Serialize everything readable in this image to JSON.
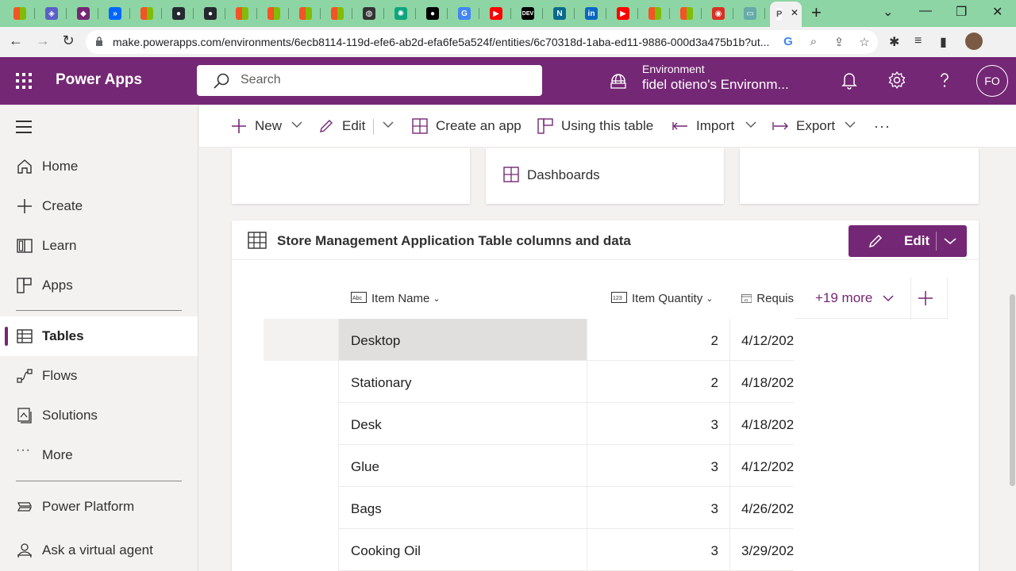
{
  "browser": {
    "active_tab_label": "P",
    "url": "make.powerapps.com/environments/6ecb8114-119d-efe6-ab2d-efa6fe5a524f/entities/6c70318d-1aba-ed11-9886-000d3a475b1b?ut...",
    "tabs": [
      {
        "icon": "microsoft-icon",
        "color": "#f35325"
      },
      {
        "icon": "power-automate-icon",
        "color": "#5b5fc7"
      },
      {
        "icon": "power-apps-icon",
        "color": "#742774"
      },
      {
        "icon": "flow-icon",
        "color": "#0066ff"
      },
      {
        "icon": "microsoft-icon",
        "color": "#f35325"
      },
      {
        "icon": "github-icon",
        "color": "#24292f"
      },
      {
        "icon": "github-icon",
        "color": "#24292f"
      },
      {
        "icon": "microsoft-icon",
        "color": "#f35325"
      },
      {
        "icon": "microsoft-icon",
        "color": "#f35325"
      },
      {
        "icon": "microsoft-icon",
        "color": "#f35325"
      },
      {
        "icon": "microsoft-icon",
        "color": "#f35325"
      },
      {
        "icon": "globe-icon",
        "color": "#333333"
      },
      {
        "icon": "openai-icon",
        "color": "#10a37f"
      },
      {
        "icon": "medium-icon",
        "color": "#000000"
      },
      {
        "icon": "google-icon",
        "color": "#4285f4"
      },
      {
        "icon": "youtube-icon",
        "color": "#ff0000"
      },
      {
        "icon": "dev-icon",
        "color": "#000000"
      },
      {
        "icon": "edge-icon",
        "color": "#0b6a8c"
      },
      {
        "icon": "linkedin-icon",
        "color": "#0a66c2"
      },
      {
        "icon": "youtube-icon",
        "color": "#ff0000"
      },
      {
        "icon": "microsoft-icon",
        "color": "#f35325"
      },
      {
        "icon": "microsoft-icon",
        "color": "#f35325"
      },
      {
        "icon": "recording-icon",
        "color": "#d93025"
      },
      {
        "icon": "extension-icon",
        "color": "#6aa"
      }
    ]
  },
  "header": {
    "app_name": "Power Apps",
    "search_placeholder": "Search",
    "environment_label": "Environment",
    "environment_name": "fidel otieno's Environm...",
    "avatar_initials": "FO",
    "brand_color": "#742774"
  },
  "nav": {
    "items": [
      {
        "label": "Home",
        "icon": "home-icon"
      },
      {
        "label": "Create",
        "icon": "plus-icon"
      },
      {
        "label": "Learn",
        "icon": "book-icon"
      },
      {
        "label": "Apps",
        "icon": "apps-icon"
      },
      {
        "label": "Tables",
        "icon": "table-icon",
        "active": true
      },
      {
        "label": "Flows",
        "icon": "flows-icon"
      },
      {
        "label": "Solutions",
        "icon": "solutions-icon"
      },
      {
        "label": "More",
        "icon": "ellipsis-icon"
      },
      {
        "label": "Power Platform",
        "icon": "power-platform-icon"
      },
      {
        "label": "Ask a virtual agent",
        "icon": "bot-icon"
      }
    ]
  },
  "commandbar": {
    "new_label": "New",
    "edit_label": "Edit",
    "create_app_label": "Create an app",
    "using_table_label": "Using this table",
    "import_label": "Import",
    "export_label": "Export",
    "more_label": "···"
  },
  "cards": {
    "dashboards_label": "Dashboards"
  },
  "panel": {
    "title": "Store Management Application Table columns and data",
    "edit_label": "Edit",
    "columns": [
      {
        "label": "Item Name",
        "icon": "text-column-icon",
        "icon_text": "Abc"
      },
      {
        "label": "Item Quantity",
        "icon": "number-column-icon",
        "icon_text": "123"
      },
      {
        "label": "Requis",
        "icon": "date-column-icon",
        "icon_text": "21"
      }
    ],
    "more_columns_label": "+19 more",
    "rows": [
      {
        "name": "Desktop",
        "quantity": "2",
        "date": "4/12/202"
      },
      {
        "name": "Stationary",
        "quantity": "2",
        "date": "4/18/202"
      },
      {
        "name": "Desk",
        "quantity": "3",
        "date": "4/18/202"
      },
      {
        "name": "Glue",
        "quantity": "3",
        "date": "4/12/202"
      },
      {
        "name": "Bags",
        "quantity": "3",
        "date": "4/26/202"
      },
      {
        "name": "Cooking Oil",
        "quantity": "3",
        "date": "3/29/202"
      }
    ]
  }
}
